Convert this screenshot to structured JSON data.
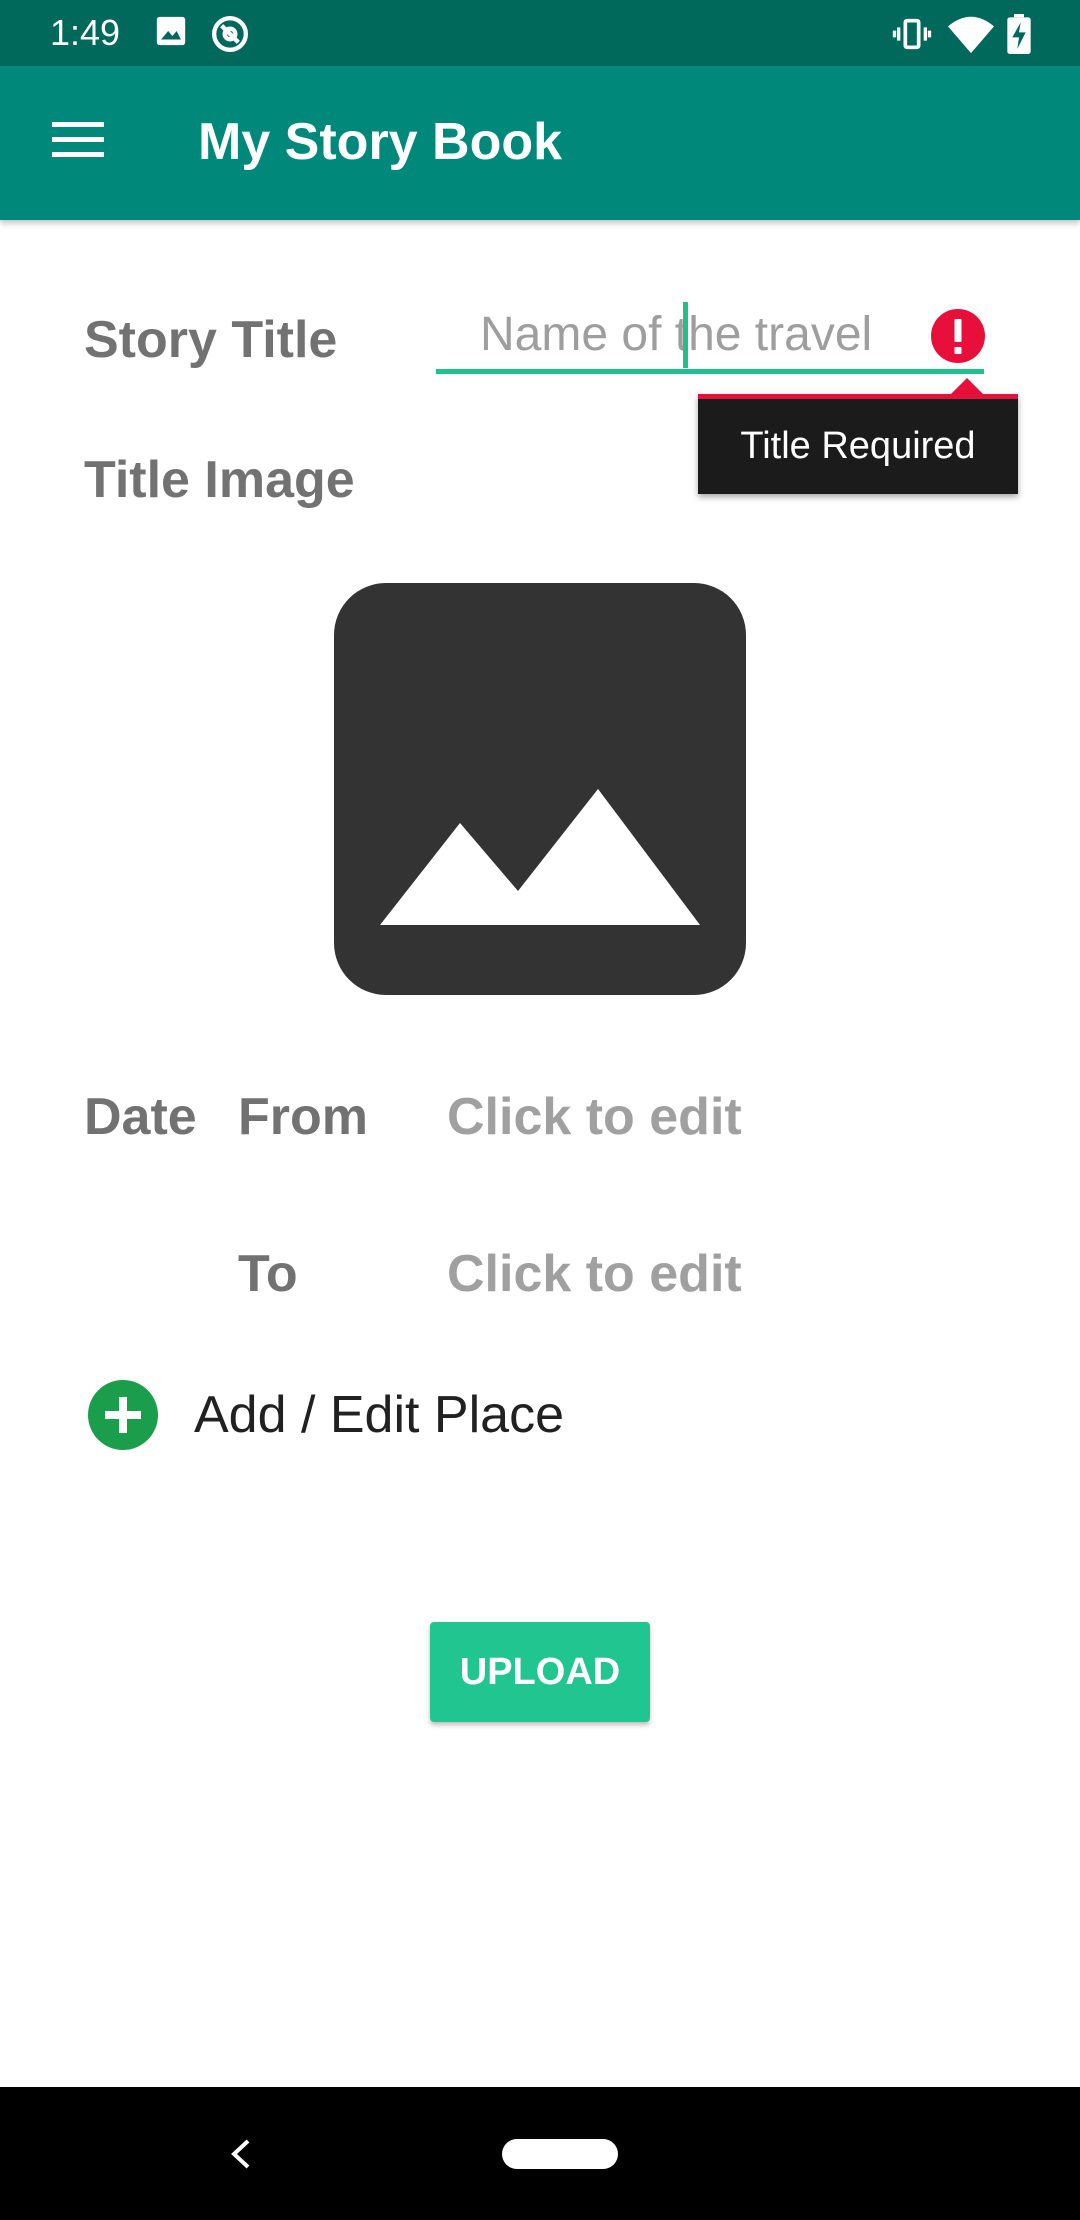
{
  "status_bar": {
    "time": "1:49",
    "left_icons": [
      "image-icon",
      "at-sign-icon"
    ],
    "right_icons": [
      "vibrate-icon",
      "wifi-icon",
      "battery-charging-icon"
    ]
  },
  "app_bar": {
    "title": "My Story Book",
    "menu_icon": "hamburger-menu-icon"
  },
  "form": {
    "story_title_label": "Story Title",
    "story_title_value": "",
    "story_title_placeholder": "Name of the travel",
    "error_message": "Title Required",
    "title_image_label": "Title Image",
    "date_label": "Date",
    "from_label": "From",
    "from_value": "Click to edit",
    "to_label": "To",
    "to_value": "Click to edit",
    "add_place_label": "Add / Edit Place",
    "upload_label": "UPLOAD"
  },
  "colors": {
    "status_bar": "#00695c",
    "app_bar": "#00897b",
    "accent": "#1fc08c",
    "error": "#e8103a",
    "add_icon": "#1b9e4b",
    "upload_button": "#21c58f"
  }
}
